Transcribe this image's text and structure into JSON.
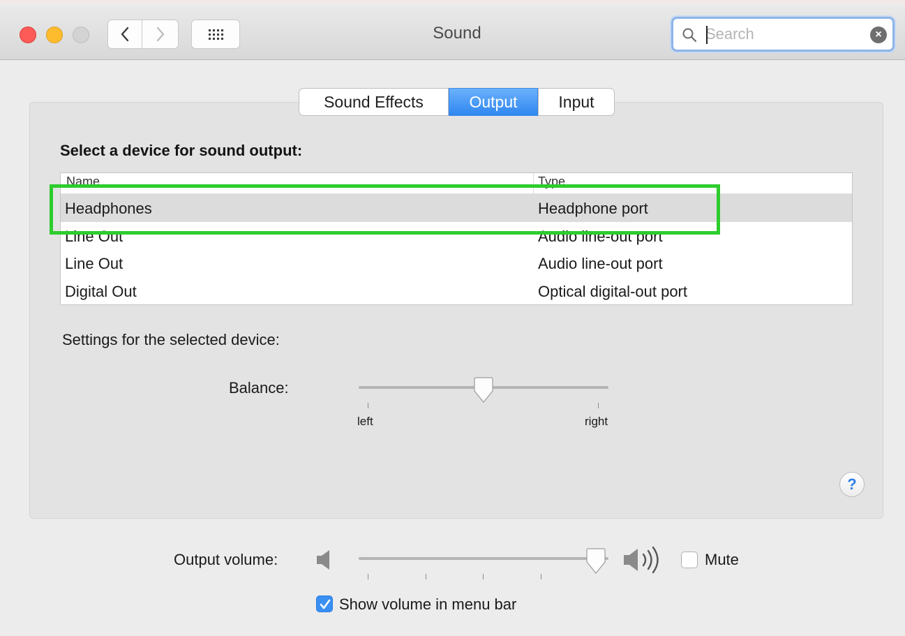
{
  "window": {
    "title": "Sound",
    "search_placeholder": "Search"
  },
  "tabs": [
    {
      "label": "Sound Effects",
      "active": false
    },
    {
      "label": "Output",
      "active": true
    },
    {
      "label": "Input",
      "active": false
    }
  ],
  "output": {
    "select_label": "Select a device for sound output:",
    "columns": [
      "Name",
      "Type"
    ],
    "devices": [
      {
        "name": "Headphones",
        "type": "Headphone port",
        "selected": true
      },
      {
        "name": "Line Out",
        "type": "Audio line-out port",
        "selected": false
      },
      {
        "name": "Line Out",
        "type": "Audio line-out port",
        "selected": false
      },
      {
        "name": "Digital Out",
        "type": "Optical digital-out port",
        "selected": false
      }
    ],
    "settings_label": "Settings for the selected device:",
    "balance": {
      "label": "Balance:",
      "left_label": "left",
      "right_label": "right",
      "value": 0.5
    },
    "help": "?"
  },
  "volume": {
    "label": "Output volume:",
    "value": 0.95,
    "mute_label": "Mute",
    "mute_checked": false,
    "show_in_menu_bar_label": "Show volume in menu bar",
    "show_in_menu_bar_checked": true
  },
  "colors": {
    "accent": "#2f87f0",
    "highlight": "#2ecc2e",
    "close": "#fc5b57",
    "minimize": "#fdbc2e"
  }
}
